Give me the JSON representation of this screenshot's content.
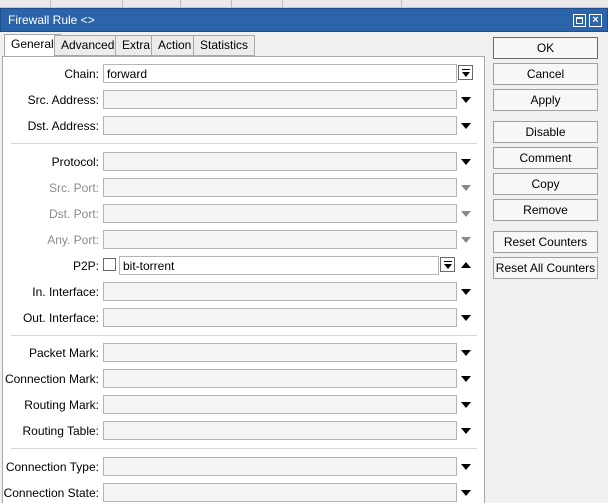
{
  "window": {
    "title": "Firewall Rule <>"
  },
  "tabs": [
    "General",
    "Advanced",
    "Extra",
    "Action",
    "Statistics"
  ],
  "form": {
    "chain": {
      "label": "Chain:",
      "value": "forward"
    },
    "src_address": {
      "label": "Src. Address:"
    },
    "dst_address": {
      "label": "Dst. Address:"
    },
    "protocol": {
      "label": "Protocol:"
    },
    "src_port": {
      "label": "Src. Port:"
    },
    "dst_port": {
      "label": "Dst. Port:"
    },
    "any_port": {
      "label": "Any. Port:"
    },
    "p2p": {
      "label": "P2P:",
      "value": "bit-torrent",
      "negated": false
    },
    "in_interface": {
      "label": "In. Interface:"
    },
    "out_interface": {
      "label": "Out. Interface:"
    },
    "packet_mark": {
      "label": "Packet Mark:"
    },
    "connection_mark": {
      "label": "Connection Mark:"
    },
    "routing_mark": {
      "label": "Routing Mark:"
    },
    "routing_table": {
      "label": "Routing Table:"
    },
    "connection_type": {
      "label": "Connection Type:"
    },
    "connection_state": {
      "label": "Connection State:"
    }
  },
  "buttons": {
    "ok": "OK",
    "cancel": "Cancel",
    "apply": "Apply",
    "disable": "Disable",
    "comment": "Comment",
    "copy": "Copy",
    "remove": "Remove",
    "reset_counters": "Reset Counters",
    "reset_all_counters": "Reset All Counters"
  },
  "colors": {
    "titlebar": "#2b64a8",
    "panel": "#ffffff",
    "background": "#f0f0f0"
  }
}
